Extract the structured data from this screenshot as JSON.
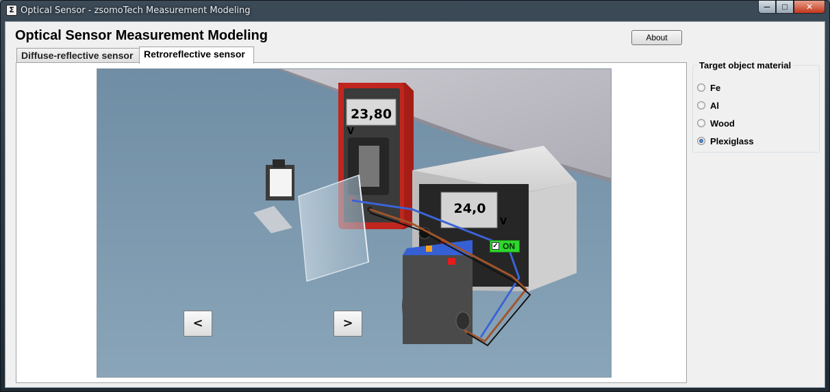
{
  "window": {
    "title": "Optical Sensor - zsomoTech Measurement Modeling",
    "app_icon_glyph": "Σ",
    "minimize_glyph": "—",
    "maximize_glyph": "□",
    "close_glyph": "✕"
  },
  "header": {
    "title": "Optical Sensor Measurement Modeling",
    "about_label": "About"
  },
  "tabs": [
    {
      "label": "Diffuse-reflective sensor",
      "active": false
    },
    {
      "label": "Retroreflective sensor",
      "active": true
    }
  ],
  "scene": {
    "multimeter": {
      "value": "23,80",
      "unit": "V"
    },
    "power_supply": {
      "value": "24,0",
      "unit": "V",
      "switch_label": "ON",
      "switch_checked": true,
      "switch_check_glyph": "✓"
    },
    "nav": {
      "prev_label": "<",
      "next_label": ">"
    }
  },
  "material_group": {
    "title": "Target object material",
    "options": [
      {
        "label": "Fe",
        "selected": false
      },
      {
        "label": "Al",
        "selected": false
      },
      {
        "label": "Wood",
        "selected": false
      },
      {
        "label": "Plexiglass",
        "selected": true
      }
    ]
  },
  "colors": {
    "floor": "#7c98ad",
    "wall": "#bdbcc4",
    "multimeter_body": "#c0261e",
    "supply_body": "#d0d0d0",
    "on_switch": "#2ed62e",
    "blue_wire": "#3b64d6",
    "brown_wire": "#a0552a"
  }
}
